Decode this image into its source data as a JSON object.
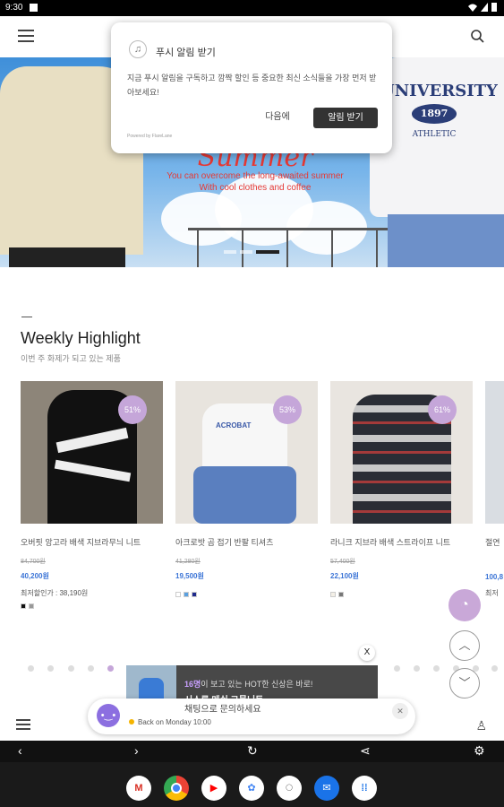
{
  "status": {
    "time": "9:30"
  },
  "popup": {
    "title": "푸시 알림 받기",
    "body": "지금 푸시 알림을 구독하고 깜짝 할인 등 중요한 최신 소식들을 가장 먼저 받아보세요!",
    "later": "다음에",
    "allow": "알림 받기",
    "powered": "Powered by FlareLane"
  },
  "hero": {
    "title": "Summer",
    "subtitle_line1": "You can overcome the long-awaited summer",
    "subtitle_line2": "With cool clothes and coffee",
    "university": "UNIVERSITY",
    "number": "1897",
    "athletic": "ATHLETIC"
  },
  "section": {
    "title": "Weekly Highlight",
    "subtitle": "이번 주 화제가 되고 있는 제품"
  },
  "products": [
    {
      "name": "오버핏 앙고라 배색 지브라무늬 니트",
      "orig": "84,700원",
      "price": "40,200원",
      "discount": "51%",
      "lowest": "최저할인가 : 38,190원"
    },
    {
      "name": "아크로밧 곰 접기 반팔 티셔츠",
      "orig": "41,280원",
      "price": "19,500원",
      "discount": "53%",
      "lowest": ""
    },
    {
      "name": "라니크 지브라 배색 스트라이프 니트",
      "orig": "57,400원",
      "price": "22,100원",
      "discount": "61%",
      "lowest": ""
    },
    {
      "name": "절연",
      "orig": "",
      "price": "100,8",
      "discount": "",
      "lowest": "최저"
    }
  ],
  "banner": {
    "close": "X",
    "count": "16명",
    "line1_rest": "이 보고 있는 HOT한 신상은 바로!",
    "line2": "시스루 메쉬 그물니트"
  },
  "chat": {
    "title": "채팅으로 문의하세요",
    "hours": "Back on Monday 10:00",
    "close": "✕"
  },
  "colors": {
    "accent": "#c5a6d9",
    "price": "#3b74d6"
  },
  "icons": [
    "menu-icon",
    "search-icon",
    "bell-icon",
    "chevron-up-icon",
    "chevron-down-icon",
    "user-icon",
    "gmail-icon",
    "chrome-icon",
    "youtube-icon",
    "photos-icon",
    "duo-icon",
    "messages-icon",
    "apps-icon"
  ]
}
